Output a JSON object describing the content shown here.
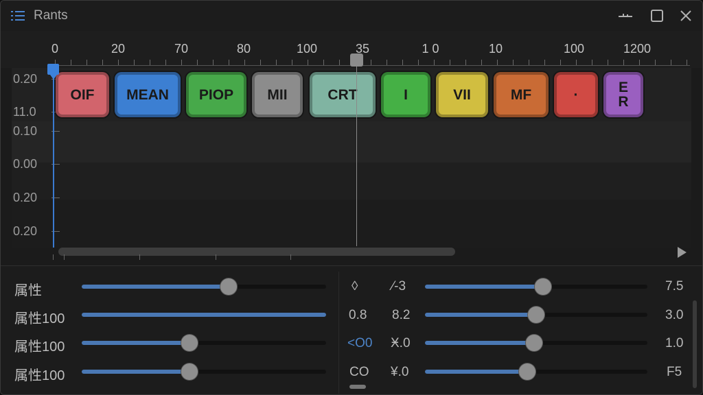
{
  "window": {
    "title": "Rants",
    "icons": {
      "menu": "list-icon",
      "minimize": "minimize-icon",
      "maximize": "maximize-icon",
      "close": "close-icon"
    }
  },
  "ruler": {
    "labels": [
      "0",
      "20",
      "70",
      "80",
      "100",
      "35",
      "1 0",
      "10",
      "100",
      "1200"
    ]
  },
  "tracks": {
    "y_labels": [
      "0.20",
      "11.0",
      "0.10",
      "0.00",
      "0.20",
      "0.20"
    ]
  },
  "clips": [
    {
      "label": "OIF",
      "color": "#d2646c"
    },
    {
      "label": "MEAN",
      "color": "#3c7fd2"
    },
    {
      "label": "PIOP",
      "color": "#47a94a"
    },
    {
      "label": "MII",
      "color": "#8c8c8c"
    },
    {
      "label": "CRT",
      "color": "#80b4a2"
    },
    {
      "label": "I",
      "color": "#45b045"
    },
    {
      "label": "VII",
      "color": "#d1be40"
    },
    {
      "label": "MF",
      "color": "#c96b35"
    },
    {
      "label": "·",
      "color": "#d04a44"
    },
    {
      "label": "E\nR",
      "color": "#9a5fc0"
    }
  ],
  "properties": {
    "left": [
      {
        "label": "属性",
        "level": 0.6,
        "value": "◊"
      },
      {
        "label": "属性100",
        "level": 1.0,
        "value": "0.8"
      },
      {
        "label": "属性100",
        "level": 0.44,
        "value": "<O0"
      },
      {
        "label": "属性100",
        "level": 0.44,
        "value": "CO"
      }
    ],
    "right": [
      {
        "label": "⁄-3",
        "level": 0.53,
        "value": "7.5"
      },
      {
        "label": "8.2",
        "level": 0.5,
        "value": "3.0"
      },
      {
        "label": "Ӿ.0",
        "level": 0.49,
        "value": "1.0"
      },
      {
        "label": "¥.0",
        "level": 0.46,
        "value": "F5"
      }
    ]
  },
  "colors": {
    "accent": "#4a78b4",
    "background": "#1b1b1b"
  }
}
